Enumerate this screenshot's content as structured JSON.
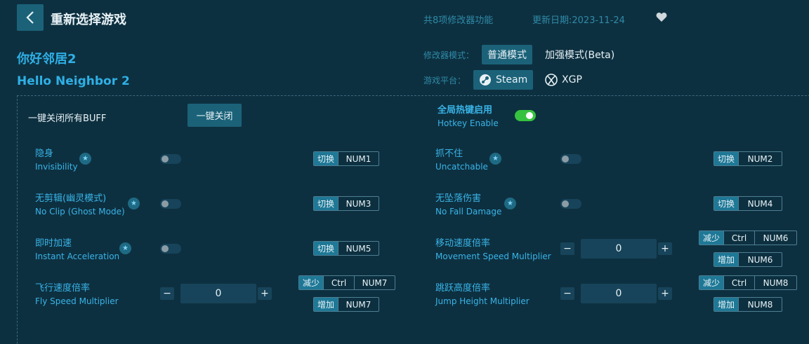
{
  "header": {
    "title": "重新选择游戏",
    "feature_count": "共8项修改器功能",
    "update_date": "更新日期:2023-11-24"
  },
  "game": {
    "name_cn": "你好邻居2",
    "name_en": "Hello Neighbor 2"
  },
  "mode": {
    "label": "修改器模式：",
    "normal": "普通模式",
    "enhanced": "加强模式(Beta)",
    "selected": "普通模式"
  },
  "platform": {
    "label": "游戏平台：",
    "steam": "Steam",
    "xgp": "XGP",
    "selected": "Steam"
  },
  "panel": {
    "close_all_label": "一键关闭所有BUFF",
    "close_all_button": "一键关闭",
    "hotkey_cn": "全局热键启用",
    "hotkey_en": "Hotkey Enable"
  },
  "actions": {
    "toggle": "切换",
    "decrease": "减少",
    "increase": "增加"
  },
  "features": {
    "invisibility": {
      "cn": "隐身",
      "en": "Invisibility",
      "key": "NUM1"
    },
    "uncatchable": {
      "cn": "抓不住",
      "en": "Uncatchable",
      "key": "NUM2"
    },
    "noclip": {
      "cn": "无剪辑(幽灵模式)",
      "en": "No Clip (Ghost Mode)",
      "key": "NUM3"
    },
    "nofall": {
      "cn": "无坠落伤害",
      "en": "No Fall Damage",
      "key": "NUM4"
    },
    "accel": {
      "cn": "即时加速",
      "en": "Instant Acceleration",
      "key": "NUM5"
    },
    "move_speed": {
      "cn": "移动速度倍率",
      "en": "Movement Speed Multiplier",
      "value": "0",
      "mod": "Ctrl",
      "dec_key": "NUM6",
      "inc_key": "NUM6"
    },
    "fly_speed": {
      "cn": "飞行速度倍率",
      "en": "Fly Speed Multiplier",
      "value": "0",
      "mod": "Ctrl",
      "dec_key": "NUM7",
      "inc_key": "NUM7"
    },
    "jump_height": {
      "cn": "跳跃高度倍率",
      "en": "Jump Height Multiplier",
      "value": "0",
      "mod": "Ctrl",
      "dec_key": "NUM8",
      "inc_key": "NUM8"
    }
  },
  "colors": {
    "background": "#0d3040",
    "accent": "#1b6279",
    "label_blue": "#39b4e8",
    "toggle_on": "#36c23e"
  }
}
